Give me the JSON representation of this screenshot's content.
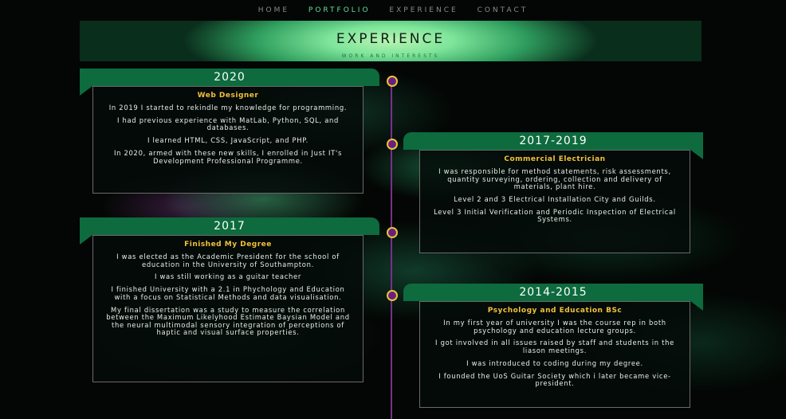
{
  "nav": {
    "items": [
      {
        "label": "HOME",
        "active": false
      },
      {
        "label": "PORTFOLIO",
        "active": true
      },
      {
        "label": "EXPERIENCE",
        "active": false
      },
      {
        "label": "CONTACT",
        "active": false
      }
    ]
  },
  "banner": {
    "title": "EXPERIENCE",
    "subtitle": "WORK AND INTERESTS"
  },
  "timeline": [
    {
      "year": "2020",
      "side": "left",
      "role": "Web Designer",
      "points": [
        "In 2019 I started to rekindle my knowledge for programming.",
        "I had previous experience with MatLab, Python, SQL, and databases.",
        "I learned HTML, CSS, JavaScript, and PHP.",
        "In 2020, armed with these new skills, I enrolled in Just IT's Development Professional Programme."
      ]
    },
    {
      "year": "2017-2019",
      "side": "right",
      "role": "Commercial Electrician",
      "points": [
        "I was responsible for method statements, risk assessments, quantity surveying, ordering, collection and delivery of materials, plant hire.",
        "Level 2 and 3 Electrical Installation City and Guilds.",
        "Level 3 Initial Verification and Periodic Inspection of Electrical Systems."
      ]
    },
    {
      "year": "2017",
      "side": "left",
      "role": "Finished My Degree",
      "points": [
        "I was elected as the Academic President for the school of education in the University of Southampton.",
        "I was still working as a guitar teacher",
        "I finished University with a 2.1 in Phychology and Education with a focus on Statistical Methods and data visualisation.",
        "My final dissertation was a study to measure the correlation between the Maximum Likelyhood Estimate Baysian Model and the neural multimodal sensory integration of perceptions of haptic and visual surface properties."
      ]
    },
    {
      "year": "2014-2015",
      "side": "right",
      "role": "Psychology and Education BSc",
      "points": [
        "In my first year of university I was the course rep in both psychology and education lecture groups.",
        "I got involved in all issues raised by staff and students in the liason meetings.",
        "I was introduced to coding during my degree.",
        "I founded the UoS Guitar Society which i later became vice-president."
      ]
    }
  ],
  "colors": {
    "accent_green": "#0d6b3e",
    "nav_active": "#5fe0a0",
    "role_gold": "#f0c23a",
    "timeline_purple": "#7a2f8c",
    "dot_border": "#e8c538"
  }
}
